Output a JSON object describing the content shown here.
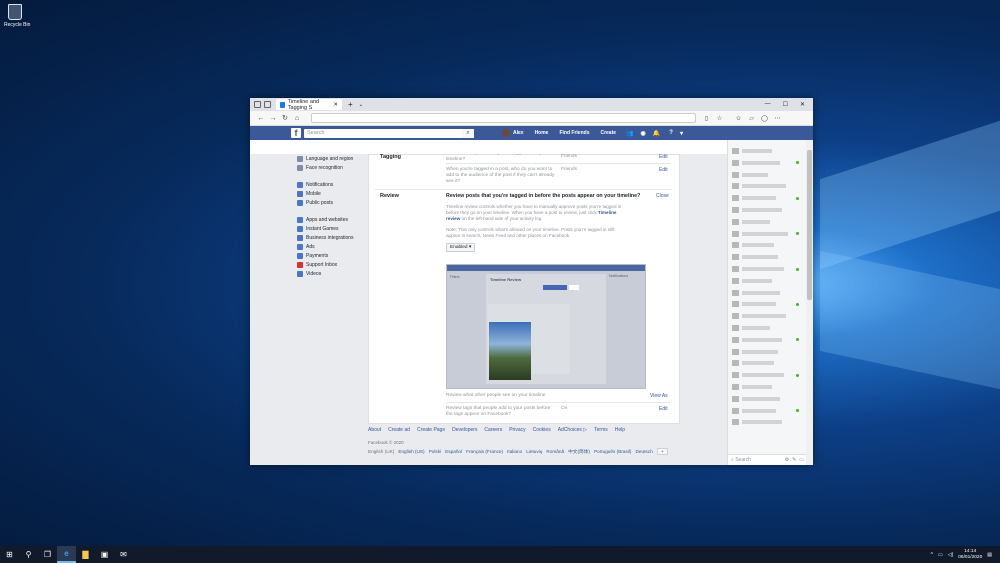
{
  "desktop": {
    "recycle_bin_label": "Recycle Bin"
  },
  "browser": {
    "tab_title": "Timeline and Tagging S",
    "tab_close": "✕",
    "new_tab": "+",
    "tab_menu": "⌄",
    "minimize": "—",
    "maximize": "☐",
    "close": "✕",
    "back": "←",
    "forward": "→",
    "refresh": "↻",
    "home": "⌂",
    "reader": "▯",
    "favorite": "☆",
    "favorites_bar": "✩",
    "collections": "▱",
    "profile": "◯",
    "more": "⋯"
  },
  "facebook": {
    "logo": "f",
    "search_placeholder": "Search",
    "search_glyph": "⌕",
    "user_name": "Alex",
    "nav_home": "Home",
    "nav_find_friends": "Find Friends",
    "nav_create": "Create",
    "icon_friends": "👥",
    "icon_messenger": "◉",
    "icon_notifications": "🔔",
    "icon_help": "?",
    "icon_menu": "▾"
  },
  "left_nav": {
    "items": [
      {
        "label": "Language and region",
        "color": "#7f8fa6"
      },
      {
        "label": "Face recognition",
        "color": "#7f8fa6"
      },
      {
        "label": "Notifications",
        "color": "#4a76c6"
      },
      {
        "label": "Mobile",
        "color": "#4a76c6"
      },
      {
        "label": "Public posts",
        "color": "#4a76c6"
      },
      {
        "label": "Apps and websites",
        "color": "#4a76c6"
      },
      {
        "label": "Instant Games",
        "color": "#4a76c6"
      },
      {
        "label": "Business integrations",
        "color": "#4a76c6"
      },
      {
        "label": "Ads",
        "color": "#4a76c6"
      },
      {
        "label": "Payments",
        "color": "#4a76c6"
      },
      {
        "label": "Support Inbox",
        "color": "#d6342a"
      },
      {
        "label": "Videos",
        "color": "#4a76c6"
      }
    ]
  },
  "settings": {
    "tagging_label": "Tagging",
    "tagging_q1": "Who can see posts that you're tagged in on your timeline?",
    "tagging_q1_value": "Friends",
    "tagging_q2": "When you're tagged in a post, who do you want to add to the audience of the post if they can't already see it?",
    "tagging_q2_value": "Friends",
    "edit": "Edit",
    "review_label": "Review",
    "review_title": "Review posts that you're tagged in before the posts appear on your timeline?",
    "close": "Close",
    "review_desc_a": "Timeline review controls whether you have to manually approve posts you're tagged in before they go on your timeline. When you have a post to review, just click ",
    "review_desc_link": "Timeline review",
    "review_desc_b": " on the left-hand side of your activity log.",
    "review_note": "Note: This only controls what's allowed on your timeline. Posts you're tagged in still appear in search, News Feed and other places on Facebook.",
    "review_select": "Enabled ▾",
    "review_q2": "Review what other people see on your timeline",
    "review_q2_action": "View As",
    "review_q3": "Review tags that people add to your posts before the tags appear on Facebook?",
    "review_q3_value": "On",
    "preview": {
      "sidebar_title": "Filters",
      "card_title": "Timeline Review",
      "right_label": "Notifications"
    }
  },
  "footer": {
    "links": [
      "About",
      "Create ad",
      "Create Page",
      "Developers",
      "Careers",
      "Privacy",
      "Cookies",
      "AdChoices ▷",
      "Terms",
      "Help"
    ],
    "copyright": "Facebook © 2020",
    "current_language": "English (UK)",
    "languages": [
      "English (US)",
      "Polski",
      "Español",
      "Français (France)",
      "Italiano",
      "Lietuvių",
      "Română",
      "中文(简体)",
      "Português (Brasil)",
      "Deutsch"
    ],
    "more_languages": "+"
  },
  "chat": {
    "search_placeholder": "Search",
    "settings_glyph": "⚙",
    "compose_glyph": "✎",
    "expand_glyph": "▭"
  },
  "taskbar": {
    "start": "⊞",
    "search": "⚲",
    "task_view": "❐",
    "edge": "e",
    "explorer": "▇",
    "store": "▣",
    "mail": "✉",
    "tray_chevron": "^",
    "network": "▭",
    "volume": "◁)",
    "time": "14:14",
    "date": "06/01/2020",
    "notifications": "▤"
  }
}
